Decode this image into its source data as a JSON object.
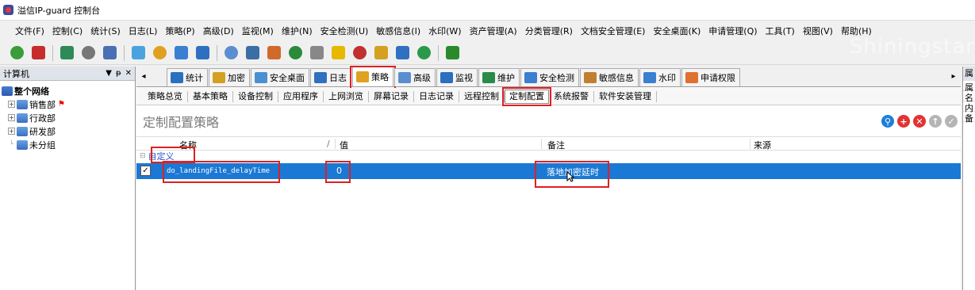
{
  "title": "溢信IP-guard 控制台",
  "watermark": "Shiningstar",
  "menu": [
    "文件(F)",
    "控制(C)",
    "统计(S)",
    "日志(L)",
    "策略(P)",
    "高级(D)",
    "监视(M)",
    "维护(N)",
    "安全检测(U)",
    "敏感信息(I)",
    "水印(W)",
    "资产管理(A)",
    "分类管理(R)",
    "文档安全管理(E)",
    "安全桌面(K)",
    "申请管理(Q)",
    "工具(T)",
    "视图(V)",
    "帮助(H)"
  ],
  "toolbar_icons": [
    "add-icon",
    "delete-icon",
    "export-icon",
    "print-icon",
    "preview-icon",
    "help-icon",
    "folder-icon",
    "copy-icon",
    "refresh-icon",
    "tile-icon",
    "monitor-icon",
    "remote-icon",
    "globe-icon",
    "usb-icon",
    "warning-icon",
    "policy-icon",
    "lock-icon",
    "edit-icon",
    "phone-icon",
    "update-icon"
  ],
  "left_pane": {
    "title": "计算机",
    "tree": [
      {
        "label": "整个网络",
        "level": 0,
        "bold": true,
        "expander": ""
      },
      {
        "label": "销售部",
        "level": 1,
        "bold": false,
        "expander": "+"
      },
      {
        "label": "行政部",
        "level": 1,
        "bold": false,
        "expander": "+"
      },
      {
        "label": "研发部",
        "level": 1,
        "bold": false,
        "expander": "+"
      },
      {
        "label": "未分组",
        "level": 1,
        "bold": false,
        "expander": ""
      }
    ]
  },
  "main_tabs": [
    "统计",
    "加密",
    "安全桌面",
    "日志",
    "策略",
    "高级",
    "监视",
    "维护",
    "安全检测",
    "敏感信息",
    "水印",
    "申请权限"
  ],
  "active_main_tab": "策略",
  "sub_tabs": [
    "策略总览",
    "基本策略",
    "设备控制",
    "应用程序",
    "上网浏览",
    "屏幕记录",
    "日志记录",
    "远程控制",
    "定制配置",
    "系统报警",
    "软件安装管理"
  ],
  "active_sub_tab": "定制配置",
  "section_title": "定制配置策略",
  "section_buttons": [
    "search-icon",
    "add-icon",
    "delete-icon",
    "move-up-icon",
    "move-down-icon"
  ],
  "table": {
    "headers": {
      "name": "名称",
      "value": "值",
      "note": "备注",
      "source": "来源"
    },
    "group": "自定义",
    "rows": [
      {
        "checked": true,
        "name": "do_landingFile_delayTime",
        "value": "0",
        "note": "落地加密延时",
        "source": ""
      }
    ]
  },
  "right_pane": {
    "title": "属",
    "lines": [
      "属",
      "名",
      "内",
      "备"
    ]
  },
  "colors": {
    "selection": "#1b78d4",
    "highlight_box": "#e02020",
    "group_text": "#2b54c5"
  }
}
